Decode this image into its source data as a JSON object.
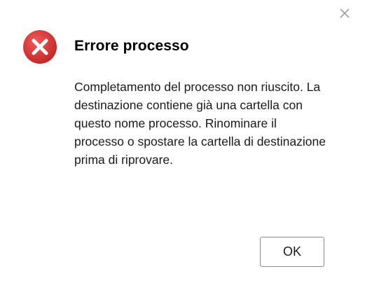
{
  "dialog": {
    "title": "Errore processo",
    "message": "Completamento del processo non riuscito. La destinazione contiene già una cartella con questo nome processo. Rinominare il processo o spostare la cartella di destinazione prima di riprovare.",
    "ok_label": "OK",
    "icon": "error-icon",
    "close_icon": "close-icon"
  },
  "colors": {
    "error_red": "#d32f2f",
    "close_gray": "#9e9e9e"
  }
}
